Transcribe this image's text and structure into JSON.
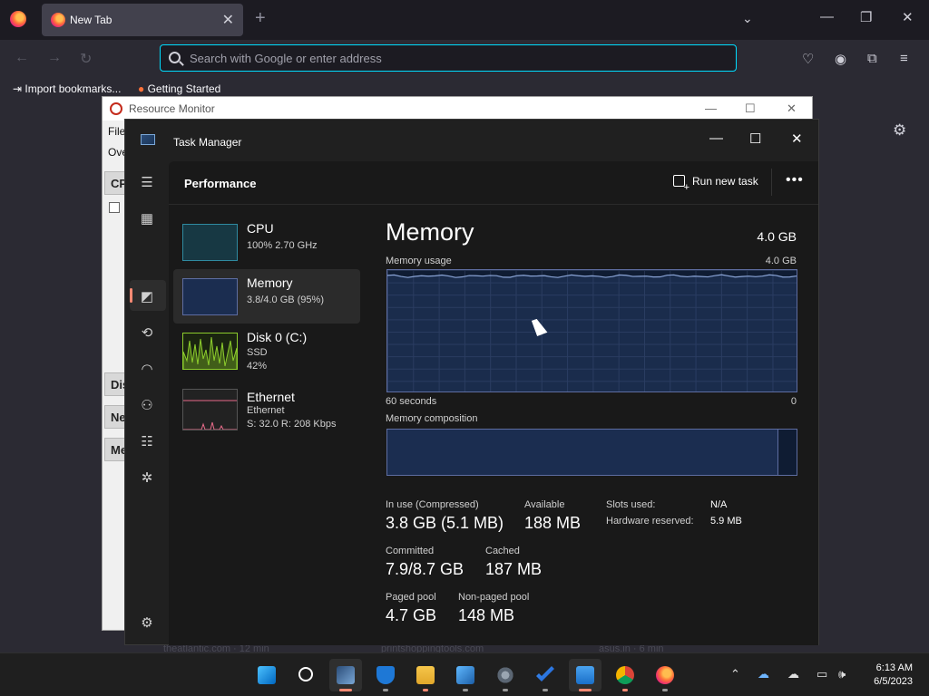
{
  "browser": {
    "tab_title": "New Tab",
    "address_placeholder": "Search with Google or enter address",
    "bookmarks": [
      "Import bookmarks...",
      "Getting Started"
    ],
    "faint_links": [
      "theatlantic.com · 12 min",
      "printshoppingtools.com",
      "asus.in · 6 min"
    ]
  },
  "resource_monitor": {
    "title": "Resource Monitor",
    "menu_first": "File",
    "tab_first": "Ove",
    "sections": [
      "CPU",
      "Disk",
      "Net",
      "Mem"
    ]
  },
  "task_manager": {
    "title": "Task Manager",
    "page": "Performance",
    "run_new_task": "Run new task",
    "more": "•••",
    "perf_items": [
      {
        "name": "CPU",
        "lines": [
          "100% 2.70 GHz"
        ]
      },
      {
        "name": "Memory",
        "lines": [
          "3.8/4.0 GB (95%)"
        ]
      },
      {
        "name": "Disk 0 (C:)",
        "lines": [
          "SSD",
          "42%"
        ]
      },
      {
        "name": "Ethernet",
        "lines": [
          "Ethernet",
          "S: 32.0 R: 208 Kbps"
        ]
      }
    ],
    "detail": {
      "title": "Memory",
      "total": "4.0 GB",
      "usage_label": "Memory usage",
      "usage_max": "4.0 GB",
      "time_label": "60 seconds",
      "zero_label": "0",
      "composition_label": "Memory composition",
      "usage_fraction": 0.95,
      "composition_in_use_fraction": 0.955,
      "stats": {
        "in_use": {
          "label": "In use (Compressed)",
          "value": "3.8 GB (5.1 MB)"
        },
        "available": {
          "label": "Available",
          "value": "188 MB"
        },
        "committed": {
          "label": "Committed",
          "value": "7.9/8.7 GB"
        },
        "cached": {
          "label": "Cached",
          "value": "187 MB"
        },
        "paged_pool": {
          "label": "Paged pool",
          "value": "4.7 GB"
        },
        "non_paged_pool": {
          "label": "Non-paged pool",
          "value": "148 MB"
        }
      },
      "kv": {
        "slots_label": "Slots used:",
        "slots_value": "N/A",
        "hw_label": "Hardware reserved:",
        "hw_value": "5.9 MB"
      }
    }
  },
  "taskbar": {
    "time": "6:13 AM",
    "date": "6/5/2023"
  },
  "colors": {
    "accent": "#ff8a74",
    "memory_graph_line": "#8aa4d6",
    "cpu_thumb": "#2f8aa0",
    "disk_thumb": "#8ccc2c",
    "net_thumb": "#e86b8a"
  }
}
